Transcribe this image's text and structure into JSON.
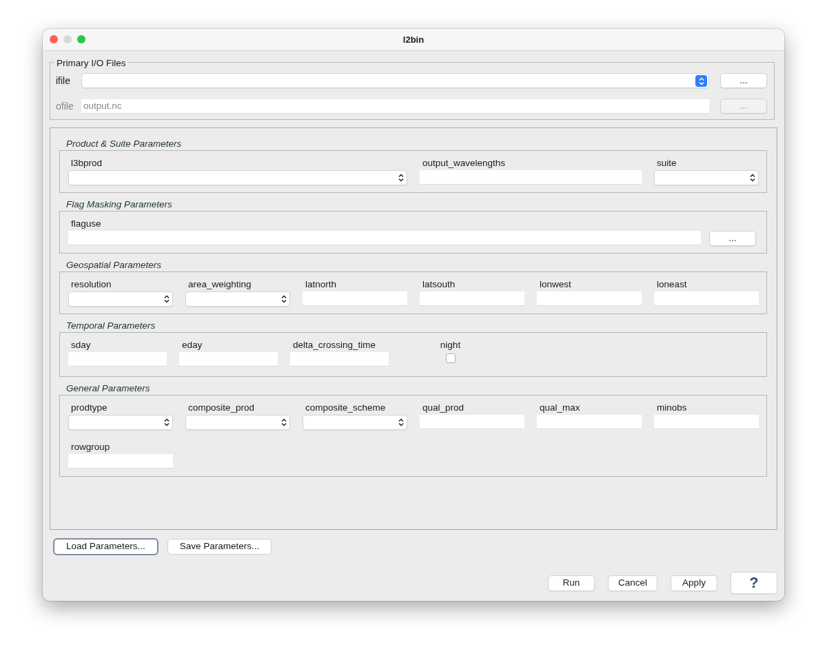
{
  "window": {
    "title": "l2bin"
  },
  "primary_io": {
    "title": "Primary I/O Files",
    "files": [
      {
        "label": "ifile",
        "kind": "combo",
        "disabled": false,
        "browse": "..."
      },
      {
        "label": "ofile",
        "kind": "text",
        "value": "output.nc",
        "disabled": true,
        "browse": "..."
      }
    ]
  },
  "sections": [
    {
      "title": "Product & Suite Parameters",
      "params": [
        {
          "label": "l3bprod",
          "kind": "combo"
        },
        {
          "label": "output_wavelengths",
          "kind": "text"
        },
        {
          "label": "suite",
          "kind": "combo"
        }
      ]
    },
    {
      "title": "Flag Masking Parameters",
      "params": [
        {
          "label": "flaguse",
          "kind": "browse",
          "button": "..."
        }
      ]
    },
    {
      "title": "Geospatial Parameters",
      "params": [
        {
          "label": "resolution",
          "kind": "combo"
        },
        {
          "label": "area_weighting",
          "kind": "combo"
        },
        {
          "label": "latnorth",
          "kind": "text"
        },
        {
          "label": "latsouth",
          "kind": "text"
        },
        {
          "label": "lonwest",
          "kind": "text"
        },
        {
          "label": "loneast",
          "kind": "text"
        }
      ]
    },
    {
      "title": "Temporal Parameters",
      "params": [
        {
          "label": "sday",
          "kind": "text"
        },
        {
          "label": "eday",
          "kind": "text"
        },
        {
          "label": "delta_crossing_time",
          "kind": "text"
        },
        {
          "label": "night",
          "kind": "checkbox",
          "checked": false
        }
      ]
    },
    {
      "title": "General Parameters",
      "params": [
        {
          "label": "prodtype",
          "kind": "combo"
        },
        {
          "label": "composite_prod",
          "kind": "combo"
        },
        {
          "label": "composite_scheme",
          "kind": "combo"
        },
        {
          "label": "qual_prod",
          "kind": "text"
        },
        {
          "label": "qual_max",
          "kind": "text"
        },
        {
          "label": "minobs",
          "kind": "text"
        },
        {
          "label": "rowgroup",
          "kind": "text"
        }
      ]
    }
  ],
  "param_buttons": [
    {
      "label": "Load Parameters...",
      "focused": true
    },
    {
      "label": "Save Parameters...",
      "focused": false
    }
  ],
  "dialog_buttons": [
    {
      "label": "Run",
      "kind": "text"
    },
    {
      "label": "Cancel",
      "kind": "text"
    },
    {
      "label": "Apply",
      "kind": "text"
    },
    {
      "label": "?",
      "kind": "help"
    }
  ]
}
